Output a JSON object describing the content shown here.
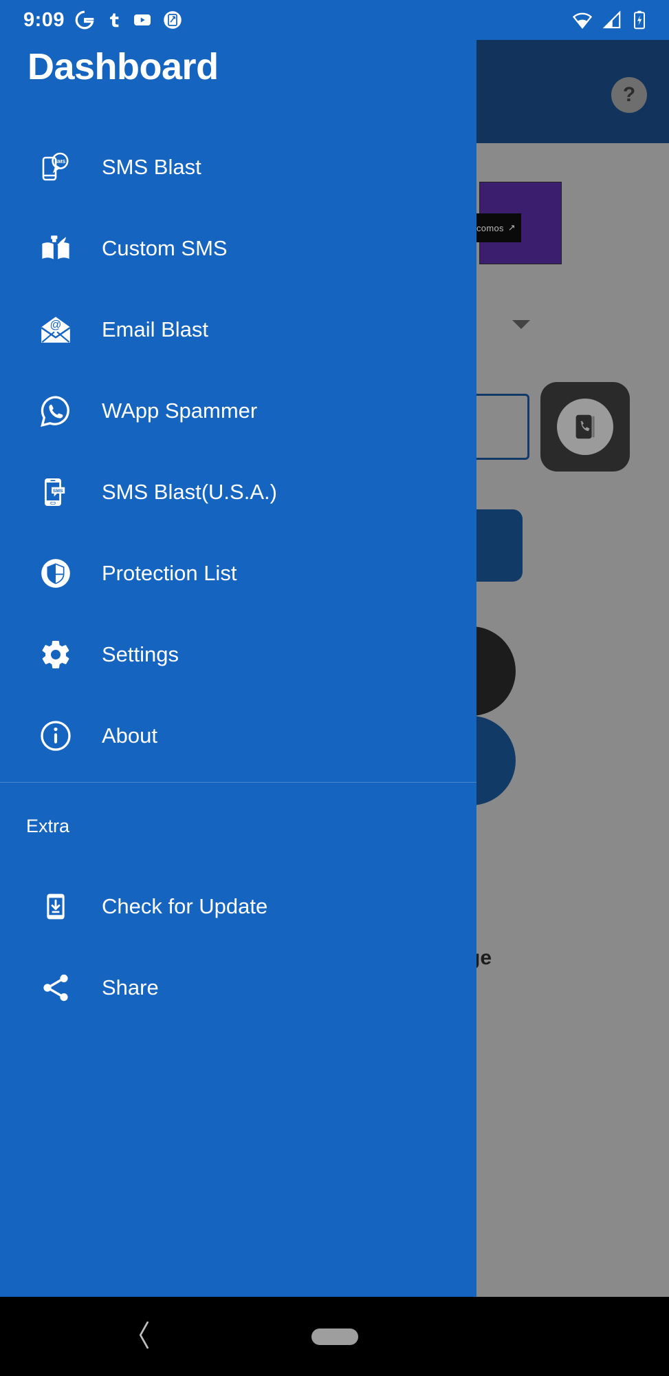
{
  "status_bar": {
    "time": "9:09",
    "left_icons": [
      "google-icon",
      "tumblr-icon",
      "youtube-icon",
      "screenshot-icon"
    ],
    "right_icons": [
      "wifi-icon",
      "cellular-signal-icon",
      "battery-charging-icon"
    ],
    "background_color": "#1565C0"
  },
  "drawer": {
    "title": "Dashboard",
    "background_color": "#1565C0",
    "items": [
      {
        "label": "SMS Blast",
        "icon": "sms-blast-icon"
      },
      {
        "label": "Custom SMS",
        "icon": "book-quill-icon"
      },
      {
        "label": "Email Blast",
        "icon": "email-envelope-icon"
      },
      {
        "label": "WApp Spammer",
        "icon": "whatsapp-icon"
      },
      {
        "label": "SMS Blast(U.S.A.)",
        "icon": "phone-sms-icon"
      },
      {
        "label": "Protection List",
        "icon": "shield-icon"
      },
      {
        "label": "Settings",
        "icon": "gear-icon"
      },
      {
        "label": "About",
        "icon": "info-icon"
      }
    ],
    "extra_section": {
      "label": "Extra",
      "items": [
        {
          "label": "Check for Update",
          "icon": "phone-download-icon"
        },
        {
          "label": "Share",
          "icon": "share-icon"
        }
      ]
    }
  },
  "background_app": {
    "appbar_color": "#12335c",
    "help_icon": "?",
    "ad_label": "pocomos",
    "cut_off_text": "ge",
    "scrim_color": "#8a8a8a"
  },
  "nav_bar": {
    "background_color": "#000000",
    "back_icon": "back-chevron-icon",
    "home_icon": "home-pill-icon"
  }
}
